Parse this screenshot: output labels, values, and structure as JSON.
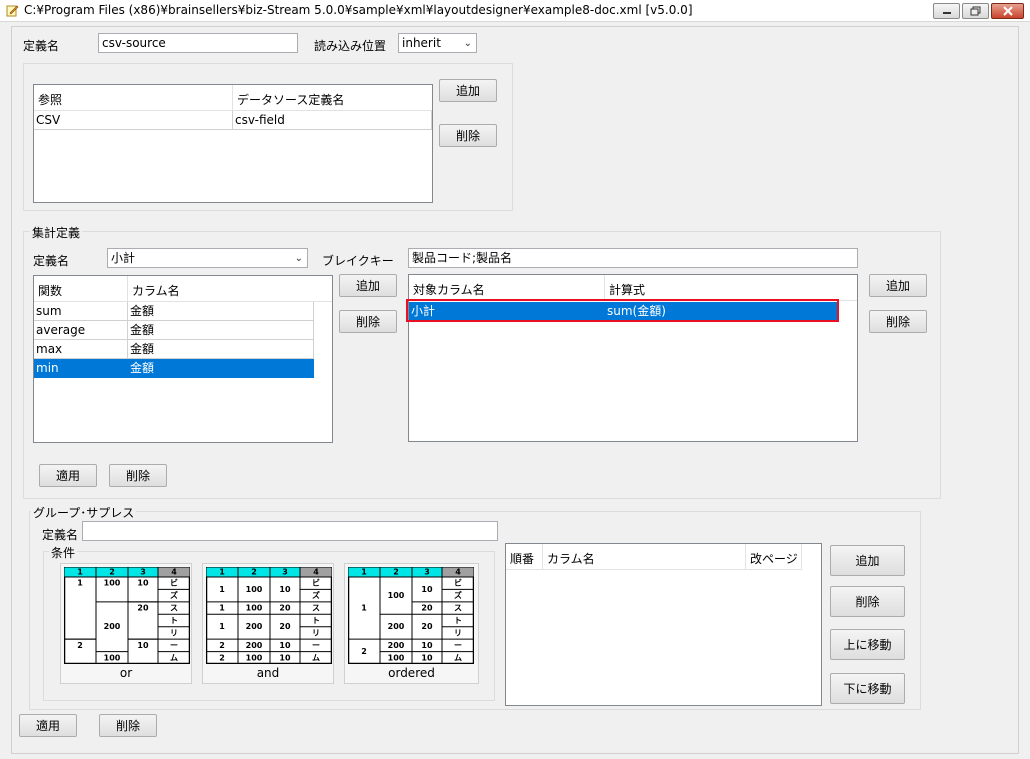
{
  "window": {
    "title": "C:¥Program Files (x86)¥brainsellers¥biz-Stream 5.0.0¥sample¥xml¥layoutdesigner¥example8-doc.xml [v5.0.0]"
  },
  "definition": {
    "name_label": "定義名",
    "name_value": "csv-source",
    "position_label": "読み込み位置",
    "position_value": "inherit"
  },
  "reference": {
    "columns": [
      "参照",
      "データソース定義名"
    ],
    "rows": [
      [
        "CSV",
        "csv-field"
      ]
    ],
    "add_label": "追加",
    "delete_label": "削除"
  },
  "aggregate": {
    "group_title": "集計定義",
    "name_label": "定義名",
    "name_value": "小計",
    "breakkey_label": "ブレイクキー",
    "breakkey_value": "製品コード;製品名",
    "func_columns": [
      "関数",
      "カラム名"
    ],
    "func_rows": [
      [
        "sum",
        "金額"
      ],
      [
        "average",
        "金額"
      ],
      [
        "max",
        "金額"
      ],
      [
        "min",
        "金額"
      ]
    ],
    "func_add_label": "追加",
    "func_delete_label": "削除",
    "target_columns": [
      "対象カラム名",
      "計算式"
    ],
    "target_rows": [
      [
        "小計",
        "sum(金額)"
      ]
    ],
    "target_add_label": "追加",
    "target_delete_label": "削除",
    "apply_label": "適用",
    "delete_label": "削除"
  },
  "group_suppress": {
    "group_title": "グループ･サプレス",
    "name_label": "定義名",
    "name_value": "",
    "condition_label": "条件",
    "modes": [
      "or",
      "and",
      "ordered"
    ],
    "order_columns": [
      "順番",
      "カラム名",
      "改ページ"
    ],
    "add_label": "追加",
    "delete_label": "削除",
    "move_up_label": "上に移動",
    "move_down_label": "下に移動"
  },
  "mini_tables": {
    "headers": [
      "1",
      "2",
      "3",
      "4"
    ],
    "or": {
      "col1": [
        "1",
        "2"
      ],
      "col2": [
        "100",
        "200",
        "100"
      ],
      "col3": [
        "10",
        "20",
        "10"
      ],
      "col4": [
        "ビ",
        "ズ",
        "ス",
        "ト",
        "リ",
        "ー",
        "ム"
      ]
    },
    "and": {
      "rows": [
        [
          "1",
          "100",
          "10"
        ],
        [
          "1",
          "100",
          "20"
        ],
        [
          "1",
          "200",
          "20"
        ],
        [
          "2",
          "200",
          "10"
        ],
        [
          "2",
          "100",
          "10"
        ]
      ],
      "col4": [
        "ビ",
        "ズ",
        "ス",
        "ト",
        "リ",
        "ー",
        "ム"
      ]
    },
    "ordered": {
      "col1": [
        "1",
        "2"
      ],
      "col2": [
        "100",
        "200",
        "200",
        "100"
      ],
      "col3": [
        "10",
        "20",
        "20",
        "10",
        "10"
      ],
      "col4": [
        "ビ",
        "ズ",
        "ス",
        "ト",
        "リ",
        "ー",
        "ム"
      ]
    }
  },
  "footer": {
    "apply_label": "適用",
    "delete_label": "削除"
  },
  "colors": {
    "selection": "#0078d7",
    "highlight": "#e81123",
    "mini_header": "#00e5e5",
    "mini_header_last": "#a0a0a0"
  }
}
